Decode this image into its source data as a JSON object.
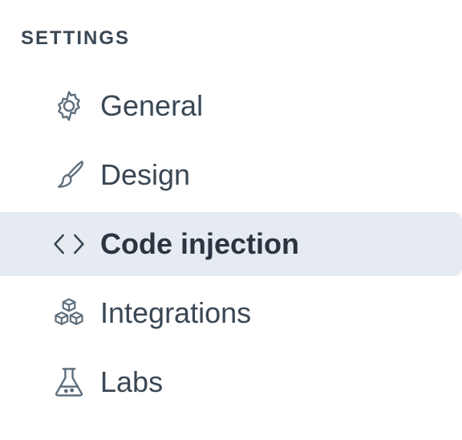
{
  "sidebar": {
    "section_title": "SETTINGS",
    "items": [
      {
        "label": "General",
        "icon": "gear-icon",
        "active": false
      },
      {
        "label": "Design",
        "icon": "paintbrush-icon",
        "active": false
      },
      {
        "label": "Code injection",
        "icon": "code-brackets-icon",
        "active": true
      },
      {
        "label": "Integrations",
        "icon": "cubes-icon",
        "active": false
      },
      {
        "label": "Labs",
        "icon": "flask-icon",
        "active": false
      }
    ]
  },
  "colors": {
    "text": "#3a4754",
    "active_background": "#e6ebf2",
    "icon_stroke": "#5f6f7d"
  }
}
